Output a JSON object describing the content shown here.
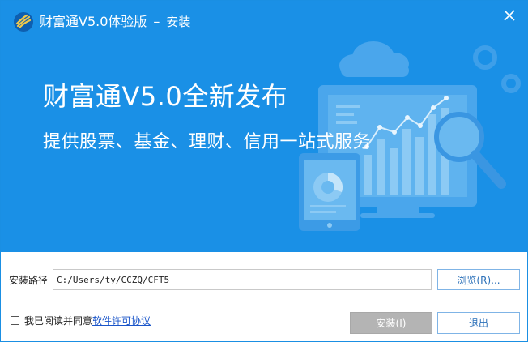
{
  "titlebar": {
    "app_name": "财富通V5.0体验版",
    "separator": "–",
    "subtitle": "安装"
  },
  "banner": {
    "headline": "财富通V5.0全新发布",
    "tagline": "提供股票、基金、理财、信用一站式服务"
  },
  "install_path": {
    "label": "安装路径",
    "value": "C:/Users/ty/CCZQ/CFT5",
    "browse_label": "浏览(R)..."
  },
  "agreement": {
    "prefix": "我已阅读并同意",
    "link_text": "软件许可协议",
    "checked": false
  },
  "buttons": {
    "install_label": "安装(I)",
    "exit_label": "退出"
  },
  "icons": {
    "logo": "wheat-logo-icon",
    "close": "close-icon"
  },
  "colors": {
    "banner_bg": "#1a90e6",
    "accent_blue": "#2a6fb8",
    "link": "#1a55c9",
    "disabled_button": "#b4b4b4"
  }
}
